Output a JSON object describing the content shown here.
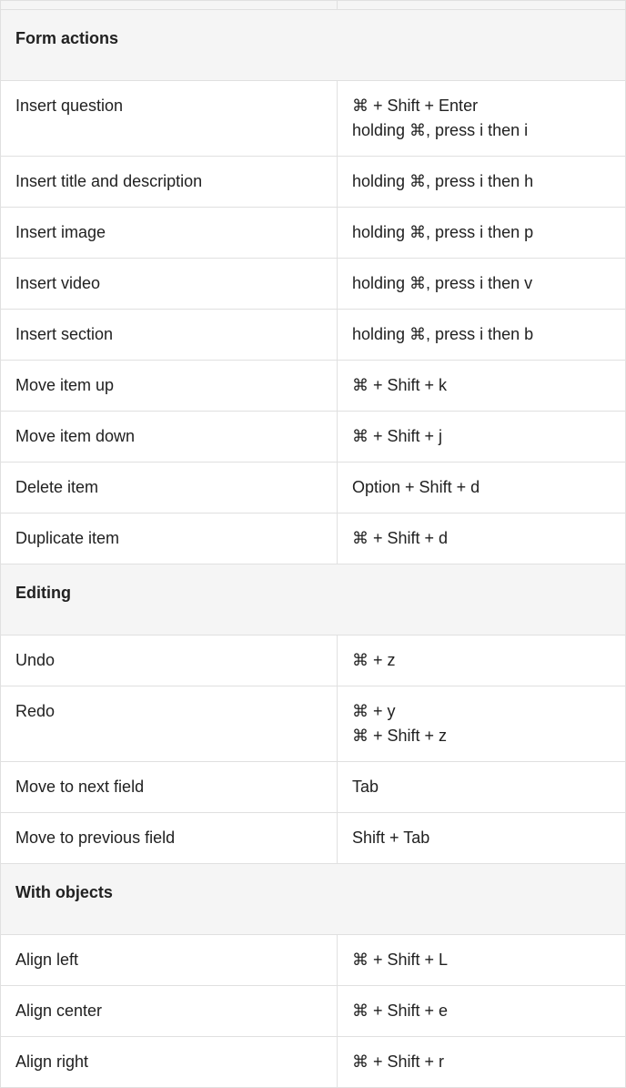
{
  "cmd": "⌘",
  "sections": [
    {
      "title": "Form actions",
      "rows": [
        {
          "action": "Insert question",
          "shortcuts": [
            "⌘ + Shift + Enter",
            "holding ⌘, press i then i"
          ]
        },
        {
          "action": "Insert title and description",
          "shortcuts": [
            "holding ⌘, press i then h"
          ]
        },
        {
          "action": "Insert image",
          "shortcuts": [
            "holding ⌘, press i then p"
          ]
        },
        {
          "action": "Insert video",
          "shortcuts": [
            "holding ⌘, press i then v"
          ]
        },
        {
          "action": "Insert section",
          "shortcuts": [
            "holding ⌘, press i then b"
          ]
        },
        {
          "action": "Move item up",
          "shortcuts": [
            "⌘ + Shift + k"
          ]
        },
        {
          "action": "Move item down",
          "shortcuts": [
            "⌘ + Shift + j"
          ]
        },
        {
          "action": "Delete item",
          "shortcuts": [
            "Option + Shift + d"
          ]
        },
        {
          "action": "Duplicate item",
          "shortcuts": [
            "⌘ + Shift + d"
          ]
        }
      ]
    },
    {
      "title": "Editing",
      "rows": [
        {
          "action": "Undo",
          "shortcuts": [
            "⌘ + z"
          ]
        },
        {
          "action": "Redo",
          "shortcuts": [
            "⌘ + y",
            "⌘ + Shift + z"
          ]
        },
        {
          "action": "Move to next field",
          "shortcuts": [
            "Tab"
          ]
        },
        {
          "action": "Move to previous field",
          "shortcuts": [
            "Shift + Tab"
          ]
        }
      ]
    },
    {
      "title": "With objects",
      "rows": [
        {
          "action": "Align left",
          "shortcuts": [
            "⌘ + Shift + L"
          ]
        },
        {
          "action": "Align center",
          "shortcuts": [
            "⌘ + Shift + e"
          ]
        },
        {
          "action": "Align right",
          "shortcuts": [
            "⌘ + Shift + r"
          ]
        }
      ]
    }
  ]
}
